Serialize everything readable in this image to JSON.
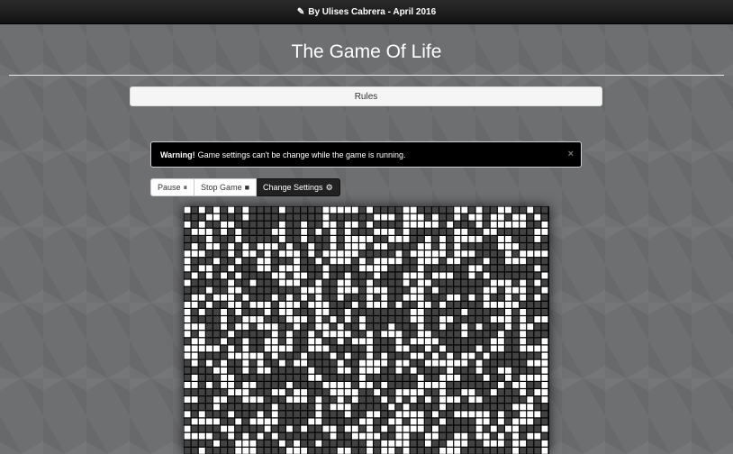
{
  "header": {
    "credit": "By Ulises Cabrera - April 2016",
    "credit_icon": "pencil-icon"
  },
  "title": "The Game Of Life",
  "rules_label": "Rules",
  "warning": {
    "strong": "Warning!",
    "text": "Game settings can't be change while the game is running.",
    "close": "×"
  },
  "controls": {
    "pause_label": "Pause",
    "pause_icon": "⏸",
    "stop_label": "Stop Game",
    "stop_icon": "■",
    "settings_label": "Change Settings",
    "settings_icon": "⚙"
  },
  "board": {
    "cols": 50,
    "rows": 34,
    "alive_color": "#ffffff",
    "dead_color": "#424242",
    "line_color": "#000000",
    "alive_density": 0.42
  },
  "colors": {
    "warning_bg": "#000000",
    "topbar_bg": "#1b1b1b"
  }
}
